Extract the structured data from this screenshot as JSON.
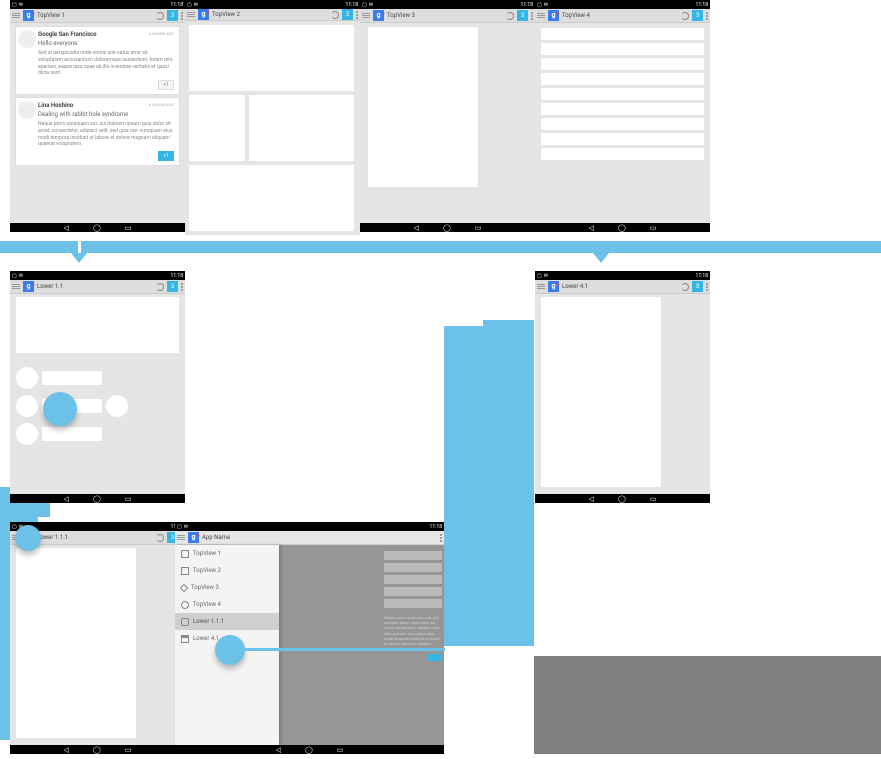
{
  "status": {
    "clock": "11:18"
  },
  "badge": "3",
  "top": [
    {
      "title": "TopView 1"
    },
    {
      "title": "TopView 2"
    },
    {
      "title": "TopView 3"
    },
    {
      "title": "TopView 4"
    }
  ],
  "cards": {
    "c1": {
      "name": "Google San Francisco",
      "time": "6 HOURS AGO",
      "sub": "Hello everyone.",
      "body": "Sed ut perspiciatis unde omnis iste natus error sit voluptatem accusantium doloremque laudantium, totam rem aperiam, eaque ipsa quae ab illo inventore veritatis et quasi dicta sunt.",
      "plus": "+1"
    },
    "c2": {
      "name": "Lina Hoshino",
      "time": "6 HOURS AGO",
      "sub": "Dealing with rabbit hole syndrome",
      "body": "Neque porro quisquam est, qui dolorem ipsum quia dolor sit amet, consectetur, adipisci velit, sed quia non numquam eius modi tempora incidunt ut labore et dolore magnam aliquam quaerat voluptatem.",
      "plus": "+1"
    }
  },
  "lower": [
    {
      "title": "Lower 1.1"
    },
    {
      "title": "Lower 4.1"
    },
    {
      "title": "Lower 1.1.1"
    }
  ],
  "drawer": {
    "app": "App Name",
    "items": [
      {
        "label": "TopView 1",
        "icon": "sq"
      },
      {
        "label": "TopView 2",
        "icon": "sq"
      },
      {
        "label": "TopView 3",
        "icon": "tag"
      },
      {
        "label": "TopView 4",
        "icon": "circ"
      },
      {
        "label": "Lower 1.1.1",
        "icon": "chat",
        "selected": true
      },
      {
        "label": "Lower 4.1",
        "icon": "fold"
      }
    ]
  },
  "glyph": {
    "logo": "g"
  }
}
